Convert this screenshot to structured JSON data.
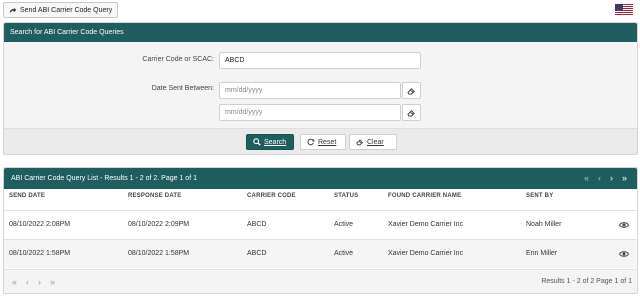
{
  "toolbar": {
    "send_label": "Send ABI Carrier Code Query",
    "flag_icon": "us-flag-icon"
  },
  "search_panel": {
    "title": "Search for ABI Carrier Code Queries",
    "carrier_label": "Carrier Code or SCAC:",
    "carrier_value": "ABCD",
    "date_label": "Date Sent Between:",
    "date_from_placeholder": "mm/dd/yyyy",
    "date_to_placeholder": "mm/dd/yyyy",
    "search_label": "Search",
    "reset_label": "Reset",
    "clear_label": "Clear"
  },
  "results": {
    "title": "ABI Carrier Code Query List - Results 1 - 2 of 2. Page 1 of 1",
    "pager": {
      "first": "«",
      "prev": "‹",
      "next": "›",
      "last": "»"
    },
    "columns": [
      "SEND DATE",
      "RESPONSE DATE",
      "CARRIER CODE",
      "STATUS",
      "FOUND CARRIER NAME",
      "SENT BY"
    ],
    "rows": [
      {
        "send_date": "08/10/2022 2:08PM",
        "response_date": "08/10/2022 2:09PM",
        "carrier_code": "ABCD",
        "status": "Active",
        "carrier_name": "Xavier Demo Carrier Inc",
        "sent_by": "Noah Miller"
      },
      {
        "send_date": "08/10/2022 1:58PM",
        "response_date": "08/10/2022 1:58PM",
        "carrier_code": "ABCD",
        "status": "Active",
        "carrier_name": "Xavier Demo Carrier Inc",
        "sent_by": "Erin Miller"
      }
    ],
    "footer_text": "Results 1 - 2 of 2 Page 1 of 1"
  },
  "colors": {
    "header": "#1f5e5e",
    "panel_bg": "#f4f4f4"
  }
}
